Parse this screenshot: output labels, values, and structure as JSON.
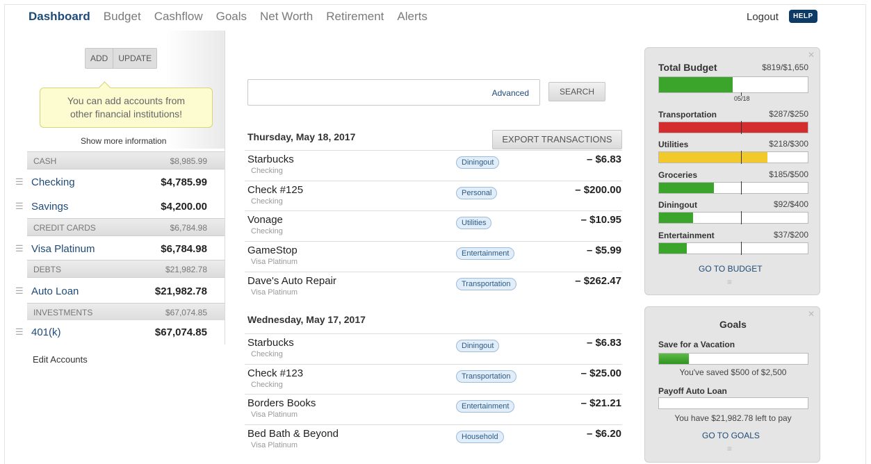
{
  "nav": {
    "items": [
      "Dashboard",
      "Budget",
      "Cashflow",
      "Goals",
      "Net Worth",
      "Retirement",
      "Alerts"
    ],
    "active": "Dashboard",
    "logout": "Logout",
    "help": "HELP"
  },
  "accounts": {
    "add_label": "ADD",
    "update_label": "UPDATE",
    "tooltip_line1": "You can add accounts from",
    "tooltip_line2": "other financial institutions!",
    "show_more": "Show more information",
    "groups": [
      {
        "name": "CASH",
        "total": "$8,985.99",
        "items": [
          {
            "name": "Checking",
            "amount": "$4,785.99"
          },
          {
            "name": "Savings",
            "amount": "$4,200.00"
          }
        ]
      },
      {
        "name": "CREDIT CARDS",
        "total": "$6,784.98",
        "items": [
          {
            "name": "Visa Platinum",
            "amount": "$6,784.98"
          }
        ]
      },
      {
        "name": "DEBTS",
        "total": "$21,982.78",
        "items": [
          {
            "name": "Auto Loan",
            "amount": "$21,982.78"
          }
        ]
      },
      {
        "name": "INVESTMENTS",
        "total": "$67,074.85",
        "items": [
          {
            "name": "401(k)",
            "amount": "$67,074.85"
          }
        ]
      }
    ],
    "edit_label": "Edit Accounts"
  },
  "search": {
    "advanced_label": "Advanced",
    "button_label": "SEARCH"
  },
  "export_label": "EXPORT TRANSACTIONS",
  "transactions": [
    {
      "date": "Thursday, May 18, 2017",
      "items": [
        {
          "name": "Starbucks",
          "account": "Checking",
          "category": "Diningout",
          "amount": "– $6.83"
        },
        {
          "name": "Check #125",
          "account": "Checking",
          "category": "Personal",
          "amount": "– $200.00"
        },
        {
          "name": "Vonage",
          "account": "Checking",
          "category": "Utilities",
          "amount": "– $10.95"
        },
        {
          "name": "GameStop",
          "account": "Visa Platinum",
          "category": "Entertainment",
          "amount": "– $5.99"
        },
        {
          "name": "Dave's Auto Repair",
          "account": "Visa Platinum",
          "category": "Transportation",
          "amount": "– $262.47"
        }
      ]
    },
    {
      "date": "Wednesday, May 17, 2017",
      "items": [
        {
          "name": "Starbucks",
          "account": "Checking",
          "category": "Diningout",
          "amount": "– $6.83"
        },
        {
          "name": "Check #123",
          "account": "Checking",
          "category": "Transportation",
          "amount": "– $25.00"
        },
        {
          "name": "Borders Books",
          "account": "Visa Platinum",
          "category": "Entertainment",
          "amount": "– $21.21"
        },
        {
          "name": "Bed Bath & Beyond",
          "account": "Visa Platinum",
          "category": "Household",
          "amount": "– $6.20"
        }
      ]
    }
  ],
  "budget": {
    "title": "Total Budget",
    "total_value": "$819/$1,650",
    "total_fraction": 0.496,
    "date_mark": "05/18",
    "colors": {
      "green": "#3aa52a",
      "red": "#d42d2d",
      "yellow": "#f2c92a"
    },
    "categories": [
      {
        "name": "Transportation",
        "value": "$287/$250",
        "fraction": 1.0,
        "color": "red"
      },
      {
        "name": "Utilities",
        "value": "$218/$300",
        "fraction": 0.727,
        "color": "yellow"
      },
      {
        "name": "Groceries",
        "value": "$185/$500",
        "fraction": 0.37,
        "color": "green"
      },
      {
        "name": "Diningout",
        "value": "$92/$400",
        "fraction": 0.23,
        "color": "green"
      },
      {
        "name": "Entertainment",
        "value": "$37/$200",
        "fraction": 0.185,
        "color": "green"
      }
    ],
    "go_label": "GO TO BUDGET"
  },
  "goals": {
    "title": "Goals",
    "items": [
      {
        "name": "Save for a Vacation",
        "fraction": 0.2,
        "note": "You've saved $500 of $2,500"
      },
      {
        "name": "Payoff Auto Loan",
        "fraction": 0.0,
        "note": "You have $21,982.78 left to pay"
      }
    ],
    "go_label": "GO TO GOALS"
  },
  "icons": {
    "close": "close-icon",
    "grip": "grip-icon",
    "drag": "drag-handle-icon"
  }
}
